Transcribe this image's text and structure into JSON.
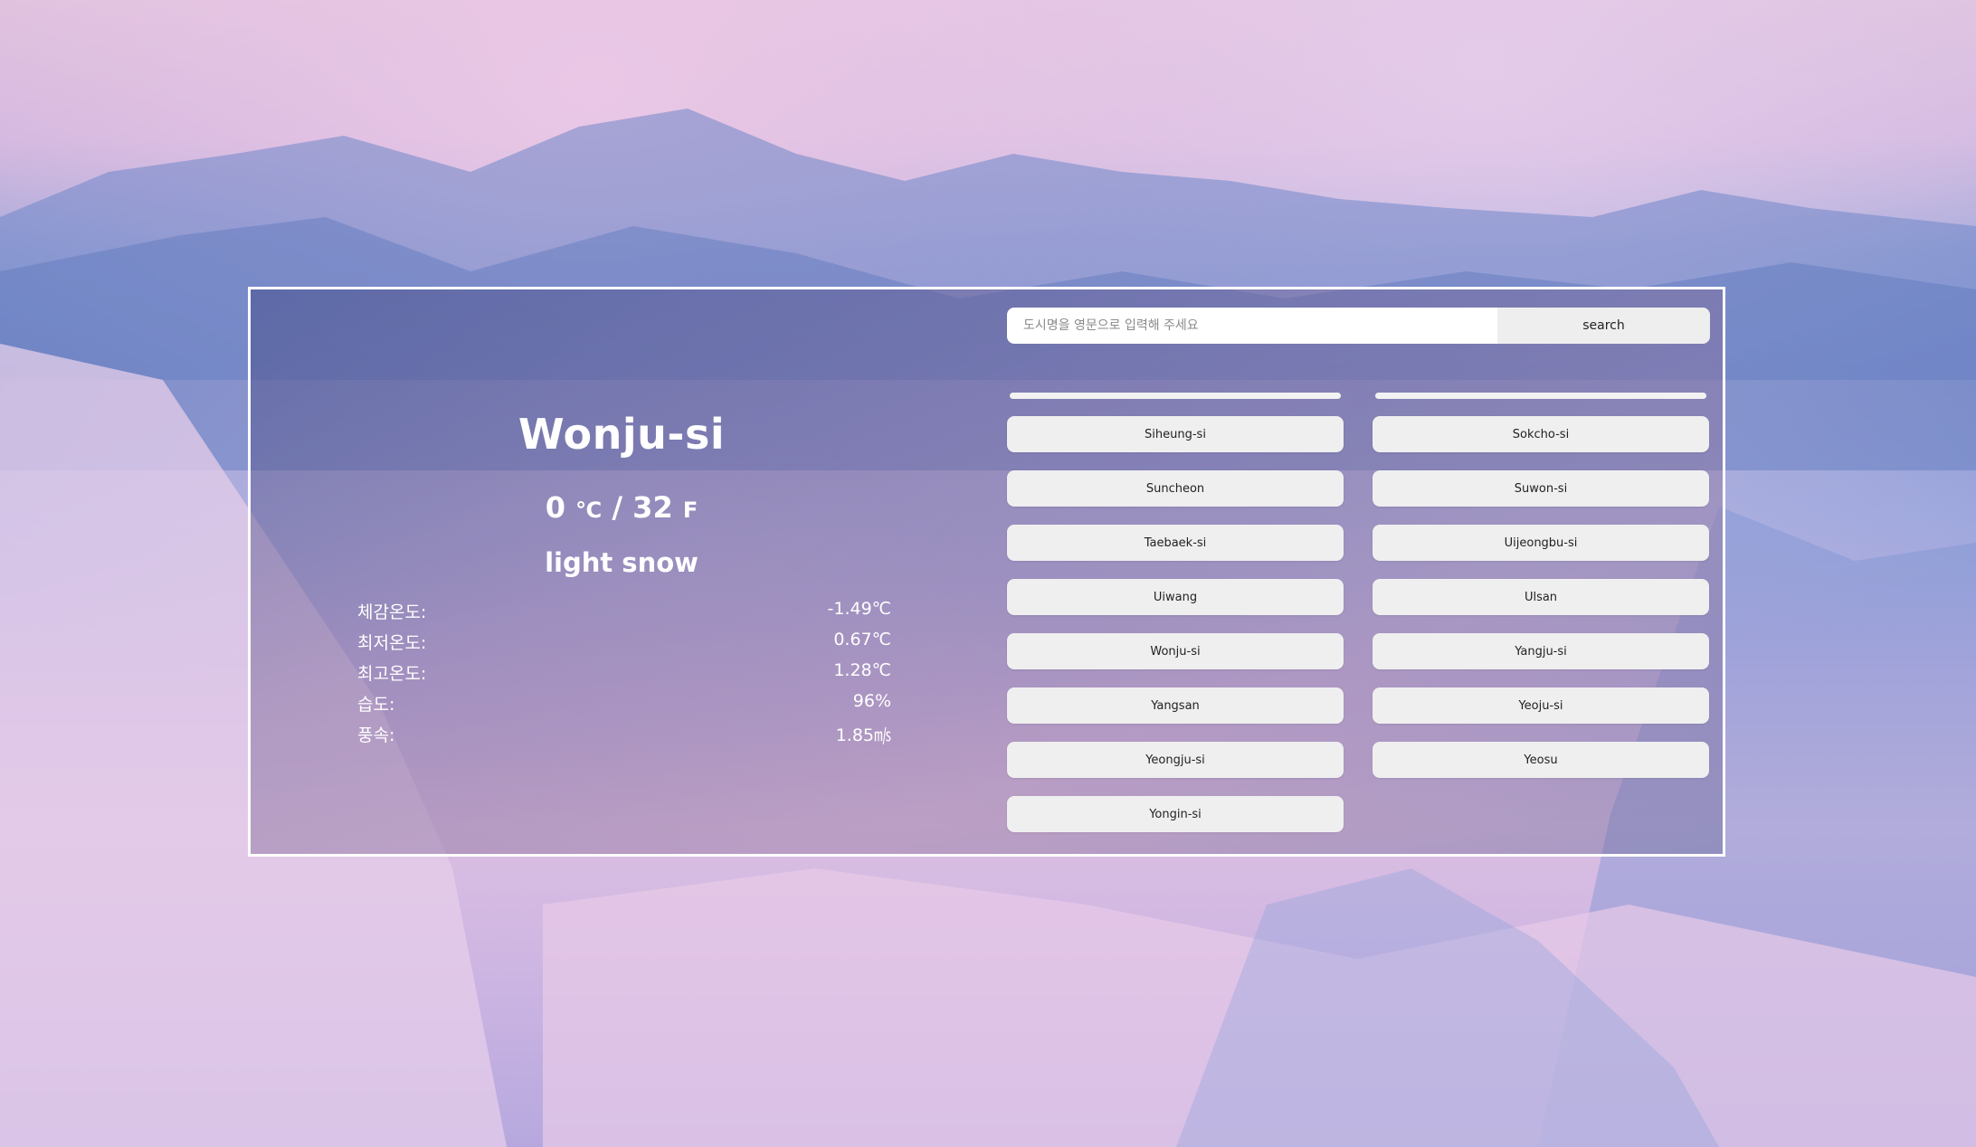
{
  "weather": {
    "city": "Wonju-si",
    "temp_c": "0",
    "unit_c": "℃",
    "separator": "/",
    "temp_f": "32",
    "unit_f": "F",
    "description": "light snow",
    "details": [
      {
        "label": "체감온도:",
        "value": "-1.49℃"
      },
      {
        "label": "최저온도:",
        "value": "0.67℃"
      },
      {
        "label": "최고온도:",
        "value": "1.28℃"
      },
      {
        "label": "습도:",
        "value": "96%"
      },
      {
        "label": "풍속:",
        "value": "1.85㎧"
      }
    ]
  },
  "search": {
    "placeholder": "도시명을 영문으로 입력해 주세요",
    "button_label": "search"
  },
  "city_list": {
    "column1": [
      "Siheung-si",
      "Suncheon",
      "Taebaek-si",
      "Uiwang",
      "Wonju-si",
      "Yangsan",
      "Yeongju-si",
      "Yongin-si"
    ],
    "column2": [
      "Sokcho-si",
      "Suwon-si",
      "Uijeongbu-si",
      "Ulsan",
      "Yangju-si",
      "Yeoju-si",
      "Yeosu"
    ]
  }
}
